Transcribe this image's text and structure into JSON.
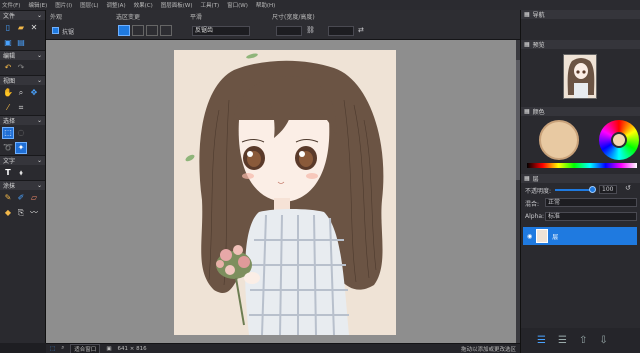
{
  "menu": [
    "文件(F)",
    "编辑(E)",
    "图片(I)",
    "图层(L)",
    "调整(A)",
    "效果(C)",
    "图层面板(W)",
    "工具(T)",
    "窗口(W)",
    "帮助(H)"
  ],
  "tools": {
    "file_header": "文件",
    "select_header": "编辑",
    "nav_header": "视图",
    "draw_header": "选择",
    "text_header": "文字",
    "paint_header": "涂抹"
  },
  "options": {
    "section1": "外观",
    "section2": "选区变更",
    "section3": "平滑",
    "section4": "尺寸(宽度/高度)",
    "antialias_label": "抗锯",
    "mode_value": "反锯齿"
  },
  "status": {
    "zoom_value": "适合窗口",
    "size_text": "641 × 816",
    "zoom_pct": "",
    "hint": "拖动以添加或更改选区"
  },
  "panels": {
    "nav_title": "导航",
    "preview_title": "预览",
    "color_title": "颜色",
    "layers_title": "层",
    "opacity_label": "不透明度:",
    "opacity_value": "100",
    "blend_label": "混合:",
    "blend_value": "正常",
    "alpha_label": "Alpha:",
    "alpha_value": "标准",
    "layer_name": "层"
  },
  "colors": {
    "accent": "#1f7ae0",
    "bg_dark": "#2a2a2f",
    "canvas_gray": "#8e8e8e",
    "artwork_bg": "#efe3d6",
    "hair": "#6b5444",
    "swatch_primary": "#e8c9a2"
  },
  "icons": [
    "new-file-icon",
    "open-file-icon",
    "close-icon",
    "save-icon",
    "undo-icon",
    "redo-icon",
    "hand-icon",
    "zoom-icon",
    "move-icon",
    "eyedropper-icon",
    "crop-icon",
    "rect-select-icon",
    "lasso-icon",
    "magic-wand-icon",
    "text-icon",
    "shape-icon",
    "brush-icon",
    "pencil-icon",
    "eraser-icon"
  ]
}
